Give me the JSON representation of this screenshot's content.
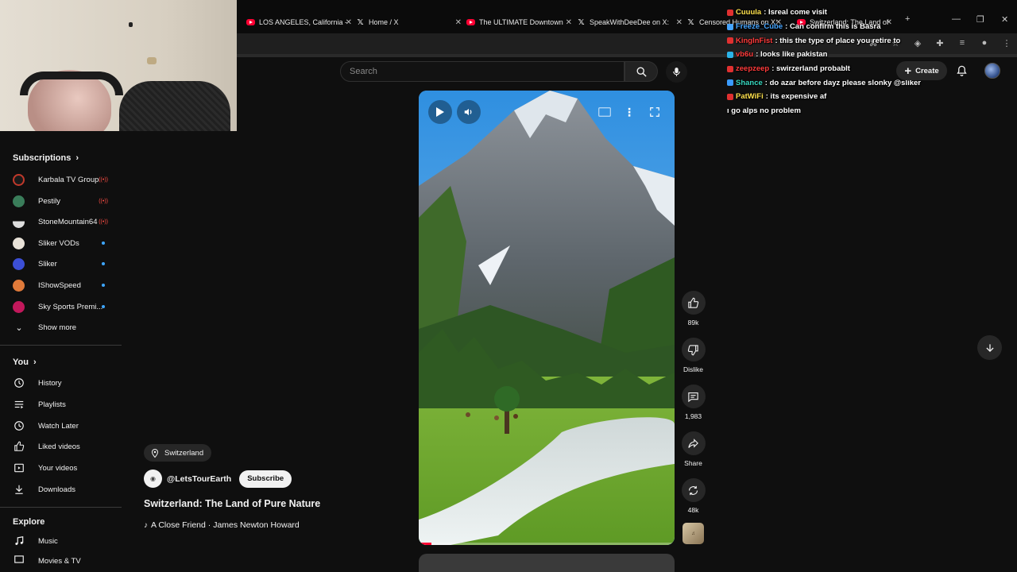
{
  "browser": {
    "tabs": [
      {
        "label": "LOS ANGELES, California -",
        "icon": "youtube-icon"
      },
      {
        "label": "Home / X",
        "icon": "x-icon"
      },
      {
        "label": "The ULTIMATE Downtown",
        "icon": "youtube-icon"
      },
      {
        "label": "SpeakWithDeeDee on X:",
        "icon": "x-icon"
      },
      {
        "label": "Censored Humans on X:",
        "icon": "x-icon"
      },
      {
        "label": "Switzerland: The Land of",
        "icon": "youtube-icon"
      }
    ]
  },
  "chat": {
    "messages": [
      {
        "user": "Cuuula",
        "text": ": Isreal come visit",
        "color": "#ffe14d",
        "badge": "#e03030"
      },
      {
        "user": "Freeze_Cube",
        "text": ": Can confirm this is Basra",
        "color": "#45a4ff",
        "badge": "#45a4ff"
      },
      {
        "user": "KingInFist",
        "text": ": this the type of place you retire to",
        "color": "#ff3b3b",
        "badge": "#e03030"
      },
      {
        "user": "vb6u",
        "text": ": looks like pakistan",
        "color": "#ff3b3b",
        "badge": "#2bb3e8"
      },
      {
        "user": "zeepzeep",
        "text": ": swirzerland probablt",
        "color": "#ff3b3b",
        "badge": "#e03030"
      },
      {
        "user": "Shance",
        "text": ": do azar before dayz please slonky @sliker",
        "color": "#37d8c0",
        "badge": "#3a9bff"
      },
      {
        "user": "PatWiFi",
        "text": ": its expensive af",
        "color": "#ffe14d",
        "badge": "#e03030"
      },
      {
        "user": "",
        "text": "ı go alps no problem",
        "color": "#ffffff",
        "badge": ""
      }
    ]
  },
  "header": {
    "search_placeholder": "Search",
    "create_label": "Create"
  },
  "sidebar": {
    "subscriptions_label": "Subscriptions",
    "channels": [
      {
        "name": "Karbala TV Group",
        "status": "live",
        "color": "#c0392b"
      },
      {
        "name": "Pestily",
        "status": "live",
        "color": "#3a7d5a"
      },
      {
        "name": "StoneMountain64",
        "status": "live",
        "color": "#dddddd"
      },
      {
        "name": "Sliker VODs",
        "status": "new",
        "color": "#e8e2d8"
      },
      {
        "name": "Sliker",
        "status": "new",
        "color": "#3c4fd6"
      },
      {
        "name": "IShowSpeed",
        "status": "new",
        "color": "#e07a3a"
      },
      {
        "name": "Sky Sports Premi...",
        "status": "new",
        "color": "#c2185b"
      }
    ],
    "live_text": "((•))",
    "show_more_label": "Show more",
    "you_label": "You",
    "you_items": [
      {
        "label": "History",
        "icon": "history-icon"
      },
      {
        "label": "Playlists",
        "icon": "playlists-icon"
      },
      {
        "label": "Watch Later",
        "icon": "watch-later-icon"
      },
      {
        "label": "Liked videos",
        "icon": "like-icon"
      },
      {
        "label": "Your videos",
        "icon": "your-videos-icon"
      },
      {
        "label": "Downloads",
        "icon": "download-icon"
      }
    ],
    "explore_label": "Explore",
    "explore_items": [
      {
        "label": "Music",
        "icon": "music-icon"
      },
      {
        "label": "Movies & TV",
        "icon": "movies-icon"
      }
    ]
  },
  "short": {
    "location": "Switzerland",
    "channel": "@LetsTourEarth",
    "subscribe_label": "Subscribe",
    "title": "Switzerland: The Land of Pure Nature",
    "music": "A Close Friend · James Newton Howard",
    "progress": 0.05,
    "likes": "89k",
    "dislike_label": "Dislike",
    "comments": "1,983",
    "share_label": "Share",
    "remix": "48k"
  }
}
